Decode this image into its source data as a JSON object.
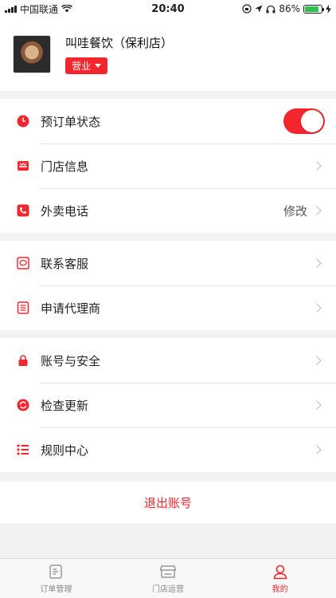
{
  "status_bar": {
    "carrier": "中国联通",
    "time": "20:40",
    "battery_percent": "86%",
    "battery_level": 0.86
  },
  "store": {
    "name": "叫哇餐饮（保利店）",
    "status": "营业"
  },
  "section1": {
    "preorder_label": "预订单状态",
    "preorder_enabled": true,
    "store_info_label": "门店信息",
    "delivery_phone_label": "外卖电话",
    "delivery_phone_value": "修改"
  },
  "section2": {
    "customer_service_label": "联系客服",
    "agent_label": "申请代理商"
  },
  "section3": {
    "account_security_label": "账号与安全",
    "check_update_label": "检查更新",
    "rules_label": "规则中心"
  },
  "logout_label": "退出账号",
  "tabs": [
    {
      "label": "订单管理",
      "icon": "order-icon"
    },
    {
      "label": "门店运营",
      "icon": "store-icon"
    },
    {
      "label": "我的",
      "icon": "profile-icon"
    }
  ],
  "colors": {
    "accent": "#f3262e",
    "battery": "#2bc24a"
  }
}
